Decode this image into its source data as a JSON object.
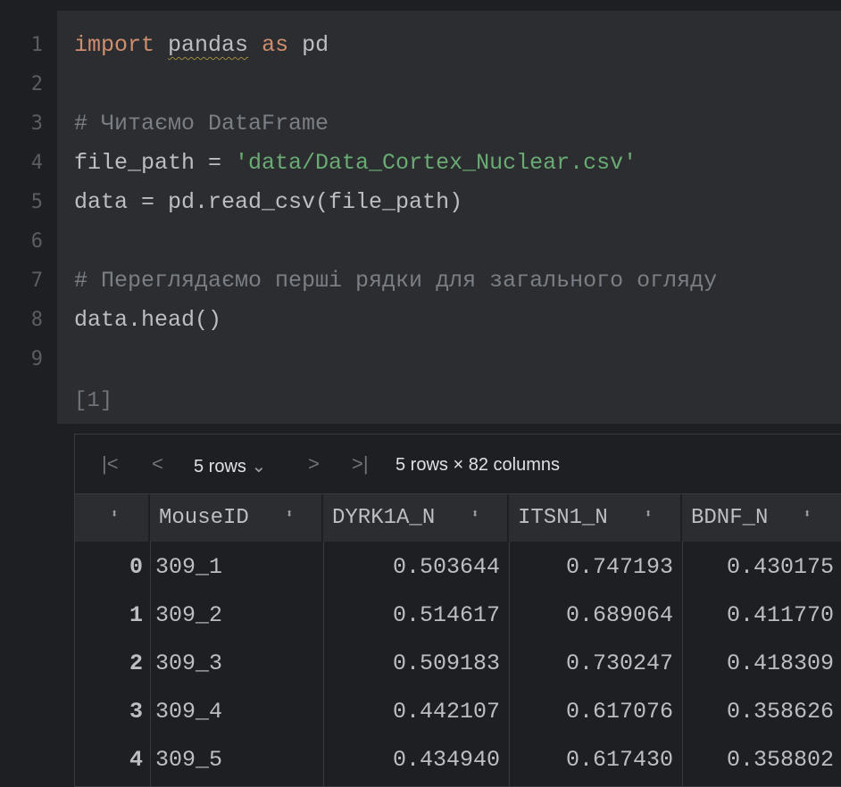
{
  "editor": {
    "line_numbers": [
      "1",
      "2",
      "3",
      "4",
      "5",
      "6",
      "7",
      "8",
      "9"
    ],
    "lines": {
      "l1": {
        "kw1": "import",
        "mod": "pandas",
        "kw2": "as",
        "alias": "pd"
      },
      "l3": "# Читаємо DataFrame",
      "l4": {
        "lhs": "file_path = ",
        "str": "'data/Data_Cortex_Nuclear.csv'"
      },
      "l5": "data = pd.read_csv(file_path)",
      "l7": "# Переглядаємо перші рядки для загального огляду",
      "l8": "data.head()"
    },
    "exec_count": "[1]"
  },
  "table": {
    "toolbar": {
      "first": "|<",
      "prev": "<",
      "rows_select": "5 rows",
      "dropdown": "⌄",
      "next": ">",
      "last": ">|",
      "summary": "5 rows × 82 columns"
    },
    "columns": [
      "",
      "MouseID",
      "DYRK1A_N",
      "ITSN1_N",
      "BDNF_N"
    ],
    "rows": [
      [
        "0",
        "309_1",
        "0.503644",
        "0.747193",
        "0.430175"
      ],
      [
        "1",
        "309_2",
        "0.514617",
        "0.689064",
        "0.411770"
      ],
      [
        "2",
        "309_3",
        "0.509183",
        "0.730247",
        "0.418309"
      ],
      [
        "3",
        "309_4",
        "0.442107",
        "0.617076",
        "0.358626"
      ],
      [
        "4",
        "309_5",
        "0.434940",
        "0.617430",
        "0.358802"
      ]
    ]
  }
}
